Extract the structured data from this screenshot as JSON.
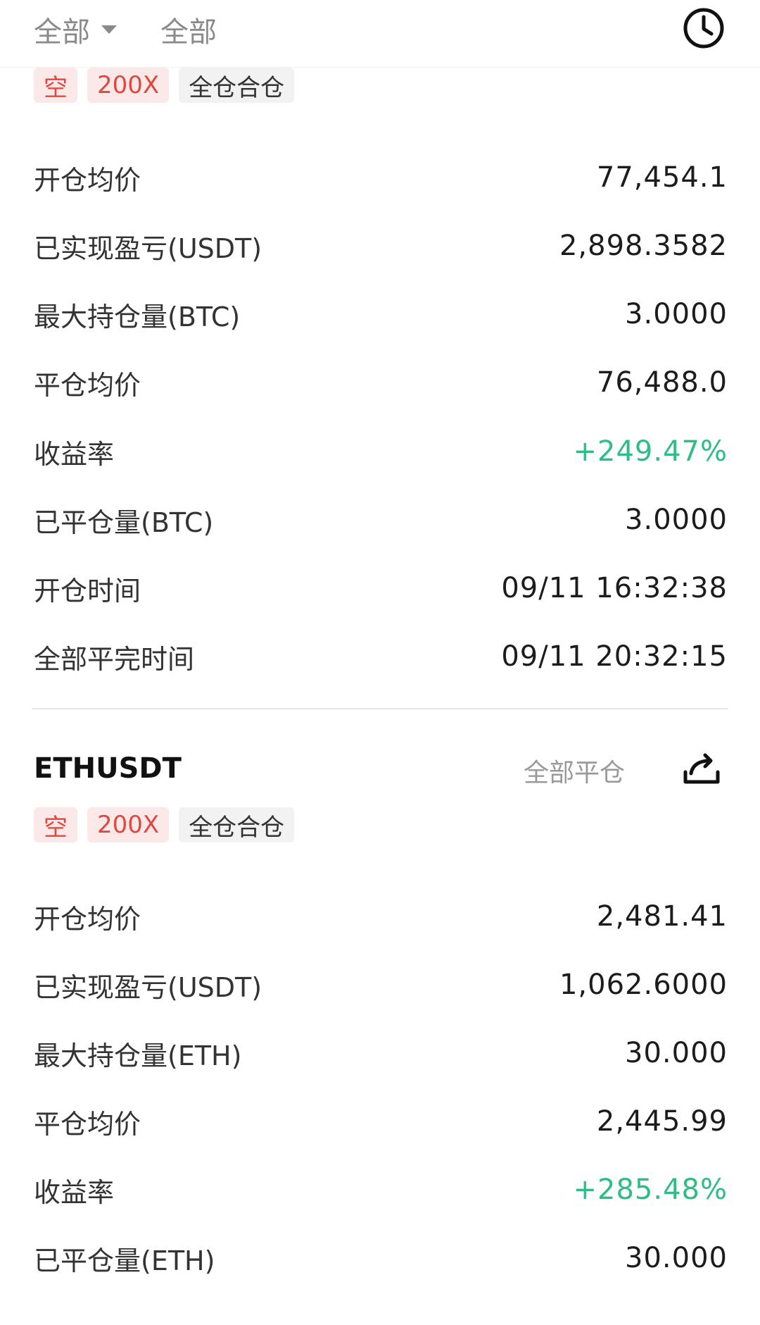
{
  "filters": [
    {
      "label": "全部"
    },
    {
      "label": "全部"
    }
  ],
  "positions": [
    {
      "symbol": "",
      "tags": [
        "空",
        "200X",
        "全仓合仓"
      ],
      "fields": [
        {
          "label": "开仓均价",
          "value": "77,454.1"
        },
        {
          "label": "已实现盈亏(USDT)",
          "value": "2,898.3582"
        },
        {
          "label": "最大持仓量(BTC)",
          "value": "3.0000"
        },
        {
          "label": "平仓均价",
          "value": "76,488.0"
        },
        {
          "label": "收益率",
          "value": "+249.47%"
        },
        {
          "label": "已平仓量(BTC)",
          "value": "3.0000"
        },
        {
          "label": "开仓时间",
          "value": "09/11 16:32:38"
        },
        {
          "label": "全部平完时间",
          "value": "09/11 20:32:15"
        }
      ]
    },
    {
      "symbol": "ETHUSDT",
      "close_all_label": "全部平仓",
      "tags": [
        "空",
        "200X",
        "全仓合仓"
      ],
      "fields": [
        {
          "label": "开仓均价",
          "value": "2,481.41"
        },
        {
          "label": "已实现盈亏(USDT)",
          "value": "1,062.6000"
        },
        {
          "label": "最大持仓量(ETH)",
          "value": "30.000"
        },
        {
          "label": "平仓均价",
          "value": "2,445.99"
        },
        {
          "label": "收益率",
          "value": "+285.48%"
        },
        {
          "label": "已平仓量(ETH)",
          "value": "30.000"
        }
      ]
    }
  ],
  "colors": {
    "profit": "#2ebd85",
    "short": "#e0483e"
  },
  "icons": {
    "history": "clock-icon",
    "share": "share-icon"
  }
}
